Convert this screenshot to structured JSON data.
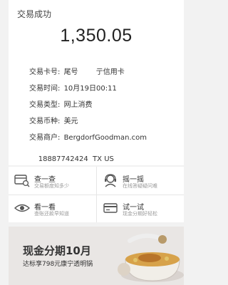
{
  "card": {
    "title": "交易成功",
    "amount": "1,350.05",
    "rows": [
      {
        "label": "交易卡号:",
        "value_prefix": "尾号",
        "value_suffix": "​亍信用卡"
      },
      {
        "label": "交易时间:",
        "value": "10月19日00:11"
      },
      {
        "label": "交易类型:",
        "value": "网上消费"
      },
      {
        "label": "交易币种:",
        "value": "美元"
      },
      {
        "label": "交易商户:",
        "value": "BergdorfGoodman.com"
      },
      {
        "label": "",
        "value": "18887742424  TX US"
      }
    ]
  },
  "services": [
    {
      "title": "查一查",
      "subtitle": "交易额度知多少",
      "icon": "card-search-icon"
    },
    {
      "title": "摇一摇",
      "subtitle": "在线答疑疑问难",
      "icon": "agent-avatar-icon"
    },
    {
      "title": "看一看",
      "subtitle": "查账还款早知道",
      "icon": "eye-icon"
    },
    {
      "title": "试一试",
      "subtitle": "现金分期好轻松",
      "icon": "credit-card-icon"
    }
  ],
  "banner": {
    "title": "现金分期10月",
    "subtitle": "达标享798元康宁透明锅"
  },
  "colors": {
    "accent_red": "#e8463b",
    "background": "#f2f2f2",
    "card": "#ffffff"
  }
}
